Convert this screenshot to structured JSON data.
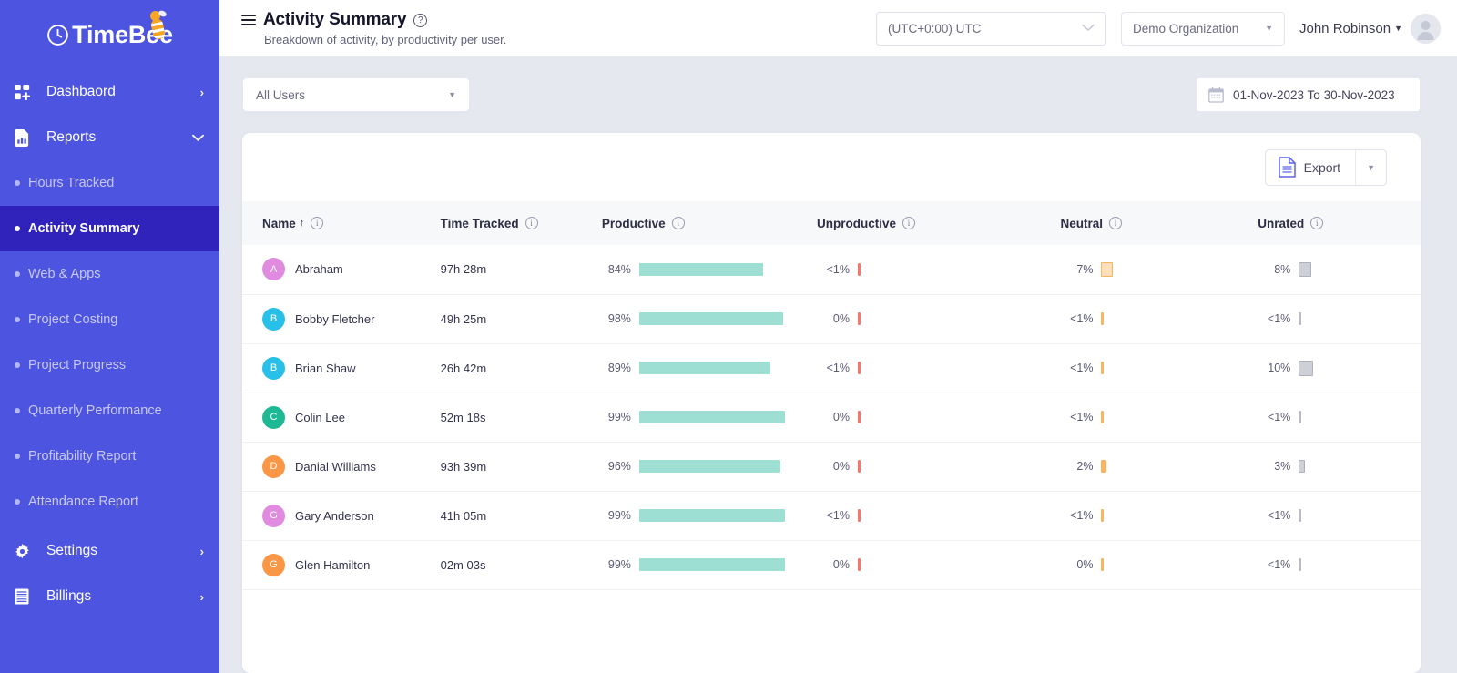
{
  "brand": {
    "name": "TimeBee",
    "logo_icon": "clock-bee-icon"
  },
  "sidebar": {
    "main_items": [
      {
        "label": "Dashbaord",
        "icon": "grid-icon",
        "chevron": "›"
      },
      {
        "label": "Reports",
        "icon": "bar-chart-icon",
        "chevron": "⌄"
      }
    ],
    "report_items": [
      {
        "label": "Hours Tracked",
        "active": false
      },
      {
        "label": "Activity Summary",
        "active": true
      },
      {
        "label": "Web & Apps",
        "active": false
      },
      {
        "label": "Project Costing",
        "active": false
      },
      {
        "label": "Project Progress",
        "active": false
      },
      {
        "label": "Quarterly Performance",
        "active": false
      },
      {
        "label": "Profitability Report",
        "active": false
      },
      {
        "label": "Attendance Report",
        "active": false
      }
    ],
    "bottom_items": [
      {
        "label": "Settings",
        "icon": "gear-icon",
        "chevron": "›"
      },
      {
        "label": "Billings",
        "icon": "ledger-icon",
        "chevron": "›"
      }
    ],
    "bg_color": "#4c54e0",
    "active_color": "#2f23bb"
  },
  "header": {
    "menu_icon": "hamburger-icon",
    "title": "Activity Summary",
    "help_icon": "question-mark-icon",
    "subtitle": "Breakdown of activity, by productivity per user.",
    "timezone": "(UTC+0:00) UTC",
    "organization": "Demo Organization",
    "user_name": "John Robinson",
    "avatar_icon": "user-avatar-icon"
  },
  "filters": {
    "user_filter": "All Users",
    "date_range": "01-Nov-2023 To 30-Nov-2023",
    "calendar_icon": "calendar-icon"
  },
  "toolbar": {
    "export_label": "Export",
    "export_icon": "document-icon",
    "dropdown_icon": "chevron-down-icon"
  },
  "table": {
    "columns": [
      {
        "label": "Name",
        "sort": "↑",
        "info": true
      },
      {
        "label": "Time Tracked",
        "info": true
      },
      {
        "label": "Productive",
        "info": true
      },
      {
        "label": "Unproductive",
        "info": true
      },
      {
        "label": "Neutral",
        "info": true
      },
      {
        "label": "Unrated",
        "info": true
      }
    ],
    "colors": {
      "productive": "#9de0d3",
      "unproductive": "#f8766b",
      "neutral": "#fcb55e",
      "unrated": "#b9bcc4"
    },
    "rows": [
      {
        "initial": "A",
        "avatar_color": "#e08ae0",
        "name": "Abraham",
        "time_tracked": "97h 28m",
        "productive": "84%",
        "productive_val": 84,
        "unproductive": "<1%",
        "unproductive_val": 0.5,
        "neutral": "7%",
        "neutral_val": 7,
        "unrated": "8%",
        "unrated_val": 8
      },
      {
        "initial": "B",
        "avatar_color": "#28c0e8",
        "name": "Bobby Fletcher",
        "time_tracked": "49h 25m",
        "productive": "98%",
        "productive_val": 98,
        "unproductive": "0%",
        "unproductive_val": 0,
        "neutral": "<1%",
        "neutral_val": 0.5,
        "unrated": "<1%",
        "unrated_val": 0.5
      },
      {
        "initial": "B",
        "avatar_color": "#28c0e8",
        "name": "Brian Shaw",
        "time_tracked": "26h 42m",
        "productive": "89%",
        "productive_val": 89,
        "unproductive": "<1%",
        "unproductive_val": 0.5,
        "neutral": "<1%",
        "neutral_val": 0.5,
        "unrated": "10%",
        "unrated_val": 10
      },
      {
        "initial": "C",
        "avatar_color": "#1eb894",
        "name": "Colin Lee",
        "time_tracked": "52m 18s",
        "productive": "99%",
        "productive_val": 99,
        "unproductive": "0%",
        "unproductive_val": 0,
        "neutral": "<1%",
        "neutral_val": 0.5,
        "unrated": "<1%",
        "unrated_val": 0.5
      },
      {
        "initial": "D",
        "avatar_color": "#f99746",
        "name": "Danial Williams",
        "time_tracked": "93h 39m",
        "productive": "96%",
        "productive_val": 96,
        "unproductive": "0%",
        "unproductive_val": 0,
        "neutral": "2%",
        "neutral_val": 2,
        "unrated": "3%",
        "unrated_val": 3
      },
      {
        "initial": "G",
        "avatar_color": "#e08ae0",
        "name": "Gary Anderson",
        "time_tracked": "41h 05m",
        "productive": "99%",
        "productive_val": 99,
        "unproductive": "<1%",
        "unproductive_val": 0.5,
        "neutral": "<1%",
        "neutral_val": 0.5,
        "unrated": "<1%",
        "unrated_val": 0.5
      },
      {
        "initial": "G",
        "avatar_color": "#f99746",
        "name": "Glen Hamilton",
        "time_tracked": "02m 03s",
        "productive": "99%",
        "productive_val": 99,
        "unproductive": "0%",
        "unproductive_val": 0,
        "neutral": "0%",
        "neutral_val": 0,
        "unrated": "<1%",
        "unrated_val": 0.5
      }
    ]
  }
}
